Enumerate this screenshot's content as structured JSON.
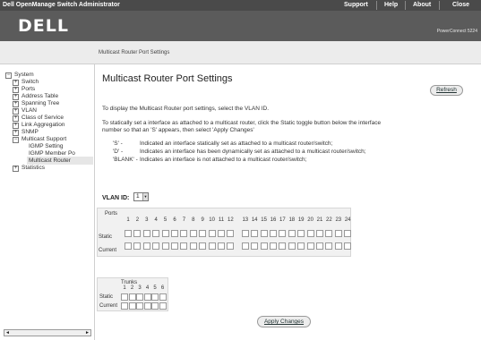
{
  "topbar": {
    "app_title": "Dell OpenManage Switch Administrator",
    "links": [
      "Support",
      "Help",
      "About",
      "Close"
    ]
  },
  "header": {
    "logo": "DELL",
    "product": "PowerConnect 5224"
  },
  "breadcrumb": "Multicast Router Port Settings",
  "nav": {
    "items": [
      {
        "label": "System",
        "expander": "−"
      },
      {
        "label": "Switch",
        "expander": "+"
      },
      {
        "label": "Ports",
        "expander": "+"
      },
      {
        "label": "Address Table",
        "expander": "+"
      },
      {
        "label": "Spanning Tree",
        "expander": "+"
      },
      {
        "label": "VLAN",
        "expander": "+"
      },
      {
        "label": "Class of Service",
        "expander": "+"
      },
      {
        "label": "Link Aggregation",
        "expander": "+"
      },
      {
        "label": "SNMP",
        "expander": "+"
      },
      {
        "label": "Multicast Support",
        "expander": "−"
      },
      {
        "label": "IGMP Setting",
        "expander": ""
      },
      {
        "label": "IGMP Member Po",
        "expander": ""
      },
      {
        "label": "Multicast Router",
        "expander": ""
      },
      {
        "label": "Statistics",
        "expander": "+"
      }
    ],
    "scroll_left": "◄",
    "scroll_right": "►"
  },
  "main": {
    "title": "Multicast Router Port Settings",
    "refresh_label": "Refresh",
    "intro": "To display the Multicast Router port settings, select the VLAN ID.",
    "instructions_1": "To statically set a interface as attached to a multicast router, click the Static toggle button below the interface",
    "instructions_2": "number so that an 'S' appears, then select 'Apply Changes'",
    "legend": [
      {
        "code": "'S' -",
        "text": "Indicated an interface statically set as attached to a multicast router/switch;"
      },
      {
        "code": "'D' -",
        "text": "Indicates an interface has been dynamically set as attached to a multicast router/switch;"
      },
      {
        "code": "'BLANK' -",
        "text": "Indicates an interface is not attached to a multicast router/switch;"
      }
    ],
    "vlan_label": "VLAN ID:",
    "vlan_value": "1",
    "vlan_dropdown_icon": "▼",
    "apply_label": "Apply Changes"
  },
  "ports_grid": {
    "title": "Ports",
    "numbers": [
      "1",
      "2",
      "3",
      "4",
      "5",
      "6",
      "7",
      "8",
      "9",
      "10",
      "11",
      "12",
      "13",
      "14",
      "15",
      "16",
      "17",
      "18",
      "19",
      "20",
      "21",
      "22",
      "23",
      "24"
    ],
    "row_static": "Static",
    "row_current": "Current"
  },
  "trunks_grid": {
    "title": "Trunks",
    "numbers": [
      "1",
      "2",
      "3",
      "4",
      "5",
      "6"
    ],
    "row_static": "Static",
    "row_current": "Current"
  }
}
